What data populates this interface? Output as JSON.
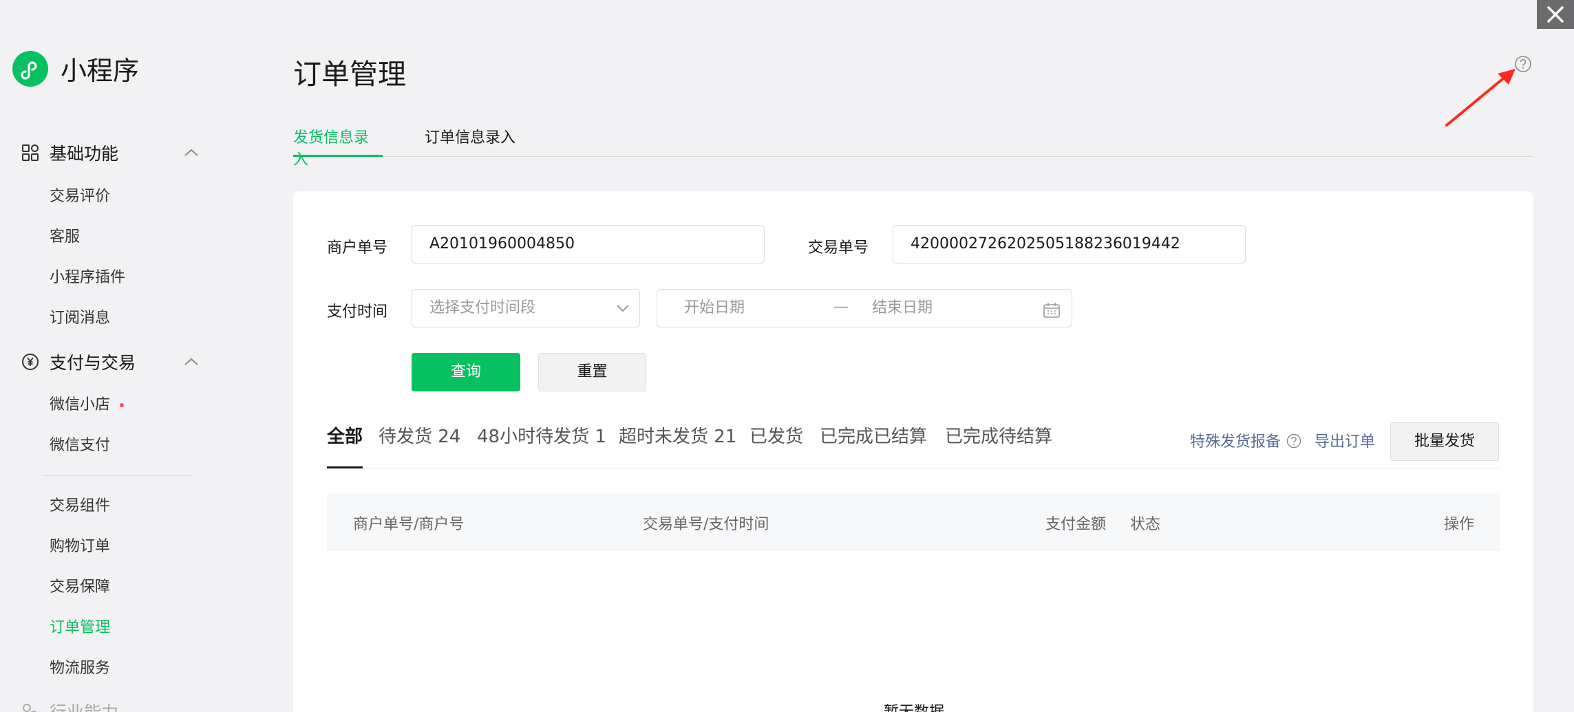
{
  "window": {
    "close_icon": "close-icon"
  },
  "brand": {
    "name": "小程序",
    "icon": "mini-program-logo"
  },
  "sidebar": {
    "groups": [
      {
        "label": "基础功能",
        "icon": "apps-grid-icon",
        "expanded": true
      },
      {
        "label": "支付与交易",
        "icon": "yuan-circle-icon",
        "expanded": true
      },
      {
        "label": "行业能力",
        "icon": "industry-icon",
        "expanded": true
      }
    ],
    "basic_items": [
      "交易评价",
      "客服",
      "小程序插件",
      "订阅消息"
    ],
    "pay_items": [
      "微信小店",
      "微信支付"
    ],
    "trade_items": [
      "交易组件",
      "购物订单",
      "交易保障",
      "订单管理",
      "物流服务"
    ],
    "active_item": "订单管理",
    "badge_color": "#fa5151"
  },
  "header": {
    "title": "订单管理",
    "help_icon": "question-circle-icon"
  },
  "top_tabs": {
    "items": [
      "发货信息录入",
      "订单信息录入"
    ],
    "active_index": 0
  },
  "filters": {
    "merchant_no": {
      "label": "商户单号",
      "value": "A20101960004850"
    },
    "trade_no": {
      "label": "交易单号",
      "value": "4200002726202505188236019442"
    },
    "pay_time": {
      "label": "支付时间",
      "select_placeholder": "选择支付时间段",
      "start_placeholder": "开始日期",
      "separator": "—",
      "end_placeholder": "结束日期"
    },
    "query_button": "查询",
    "reset_button": "重置"
  },
  "status_tabs": {
    "items": [
      "全部",
      "待发货 24",
      "48小时待发货 1",
      "超时未发货 21",
      "已发货",
      "已完成已结算",
      "已完成待结算"
    ],
    "active_index": 0
  },
  "toolbar": {
    "special_report": "特殊发货报备",
    "export": "导出订单",
    "batch_ship": "批量发货"
  },
  "table": {
    "columns": [
      "商户单号/商户号",
      "交易单号/支付时间",
      "支付金额",
      "状态",
      "操作"
    ],
    "empty_text": "暂无数据"
  },
  "colors": {
    "accent": "#07c160",
    "link": "#576b95",
    "annotation_arrow": "#ff2a1f"
  }
}
